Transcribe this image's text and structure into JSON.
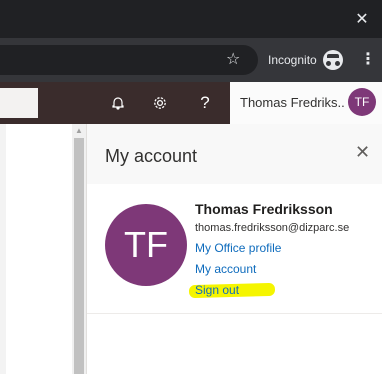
{
  "browser": {
    "incognito_label": "Incognito"
  },
  "header": {
    "user_display_name": "Thomas Fredriks..",
    "avatar_initials": "TF"
  },
  "panel": {
    "title": "My account",
    "full_name": "Thomas Fredriksson",
    "email": "thomas.fredriksson@dizparc.se",
    "avatar_initials": "TF",
    "links": {
      "office_profile": "My Office profile",
      "my_account": "My account",
      "sign_out": "Sign out"
    }
  },
  "colors": {
    "avatar": "#7e3878",
    "link": "#0f6cbd",
    "highlight": "#f5f500",
    "suitebar": "#3a2c2c"
  }
}
